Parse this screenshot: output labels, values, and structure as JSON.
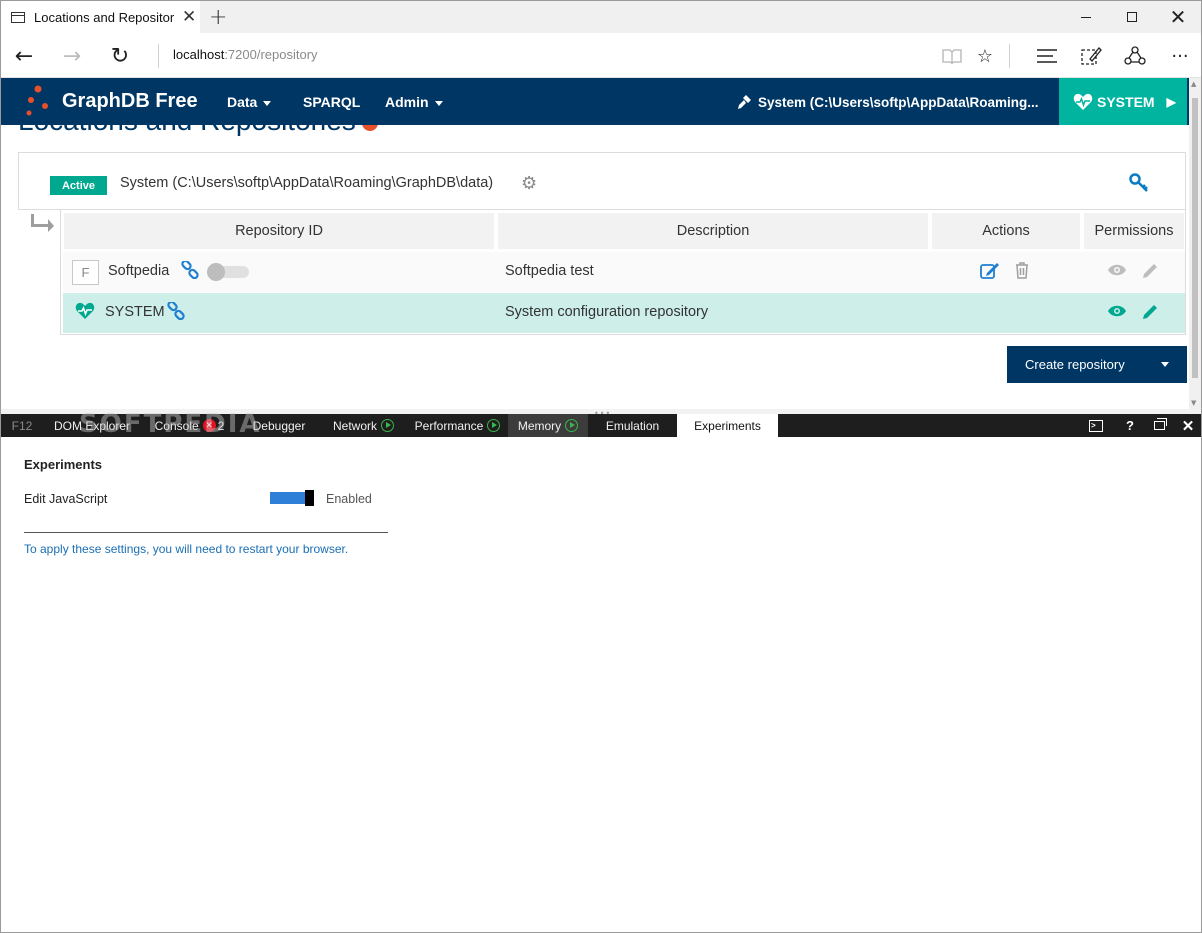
{
  "browser": {
    "tab_title": "Locations and Repositor",
    "tab_close": "✕",
    "new_tab": "+",
    "url_host": "localhost",
    "url_rest": ":7200/repository",
    "icons": [
      "back-arrow-icon",
      "forward-arrow-icon",
      "refresh-icon",
      "reading-view-icon",
      "favorite-star-icon",
      "hub-icon",
      "web-note-icon",
      "share-icon",
      "more-icon"
    ]
  },
  "graphdb": {
    "brand": "GraphDB Free",
    "menu": [
      {
        "label": "Data",
        "has_caret": true
      },
      {
        "label": "SPARQL",
        "has_caret": false
      },
      {
        "label": "Admin",
        "has_caret": true
      }
    ],
    "location_label": "System (C:\\Users\\softp\\AppData\\Roaming...",
    "repo_button": "SYSTEM",
    "colors": {
      "header_bg": "#003663",
      "accent": "#00b4a0",
      "active_row": "#cdeee9"
    }
  },
  "page": {
    "title": "Locations and Repositories",
    "location": {
      "status": "Active",
      "path": "System (C:\\Users\\softp\\AppData\\Roaming\\GraphDB\\data)"
    },
    "table": {
      "headers": [
        "Repository ID",
        "Description",
        "Actions",
        "Permissions"
      ],
      "rows": [
        {
          "badge": "F",
          "id": "Softpedia",
          "description": "Softpedia test",
          "active": false
        },
        {
          "badge": "",
          "id": "SYSTEM",
          "description": "System configuration repository",
          "active": true
        }
      ]
    },
    "create_button": "Create repository"
  },
  "devtools": {
    "tabs": [
      {
        "label": "F12"
      },
      {
        "label": "DOM Explorer"
      },
      {
        "label": "Console",
        "error_count": "2"
      },
      {
        "label": "Debugger"
      },
      {
        "label": "Network"
      },
      {
        "label": "Performance"
      },
      {
        "label": "Memory"
      },
      {
        "label": "Emulation"
      },
      {
        "label": "Experiments"
      }
    ],
    "controls": [
      "console-icon",
      "help-icon",
      "undock-icon",
      "close-icon"
    ],
    "help_label": "?",
    "experiments": {
      "heading": "Experiments",
      "setting_label": "Edit JavaScript",
      "setting_status": "Enabled",
      "note": "To apply these settings, you will need to restart your browser."
    }
  },
  "watermark": "SOFTPEDIA"
}
